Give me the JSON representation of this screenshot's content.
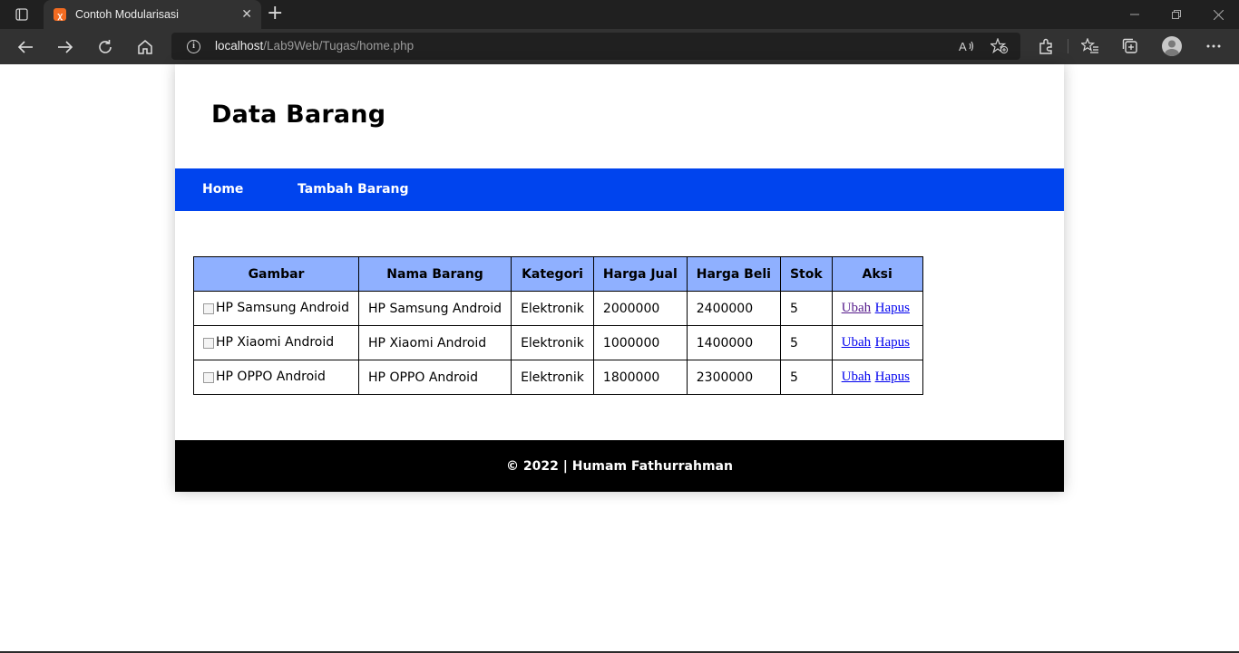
{
  "browser": {
    "tab_title": "Contoh Modularisasi",
    "url_host": "localhost",
    "url_path": "/Lab9Web/Tugas/home.php"
  },
  "page": {
    "title": "Data Barang",
    "nav": [
      {
        "label": "Home"
      },
      {
        "label": "Tambah Barang"
      }
    ],
    "table": {
      "headers": [
        "Gambar",
        "Nama Barang",
        "Kategori",
        "Harga Jual",
        "Harga Beli",
        "Stok",
        "Aksi"
      ],
      "rows": [
        {
          "gambar_alt": "HP Samsung Android",
          "nama": "HP Samsung Android",
          "kategori": "Elektronik",
          "harga_jual": "2000000",
          "harga_beli": "2400000",
          "stok": "5",
          "ubah": "Ubah",
          "hapus": "Hapus"
        },
        {
          "gambar_alt": "HP Xiaomi Android",
          "nama": "HP Xiaomi Android",
          "kategori": "Elektronik",
          "harga_jual": "1000000",
          "harga_beli": "1400000",
          "stok": "5",
          "ubah": "Ubah",
          "hapus": "Hapus"
        },
        {
          "gambar_alt": "HP OPPO Android",
          "nama": "HP OPPO Android",
          "kategori": "Elektronik",
          "harga_jual": "1800000",
          "harga_beli": "2300000",
          "stok": "5",
          "ubah": "Ubah",
          "hapus": "Hapus"
        }
      ]
    },
    "footer": "© 2022 | Humam Fathurrahman"
  },
  "colors": {
    "navbar": "#0044ee",
    "table_header": "#8fb0ff",
    "footer": "#000000"
  }
}
